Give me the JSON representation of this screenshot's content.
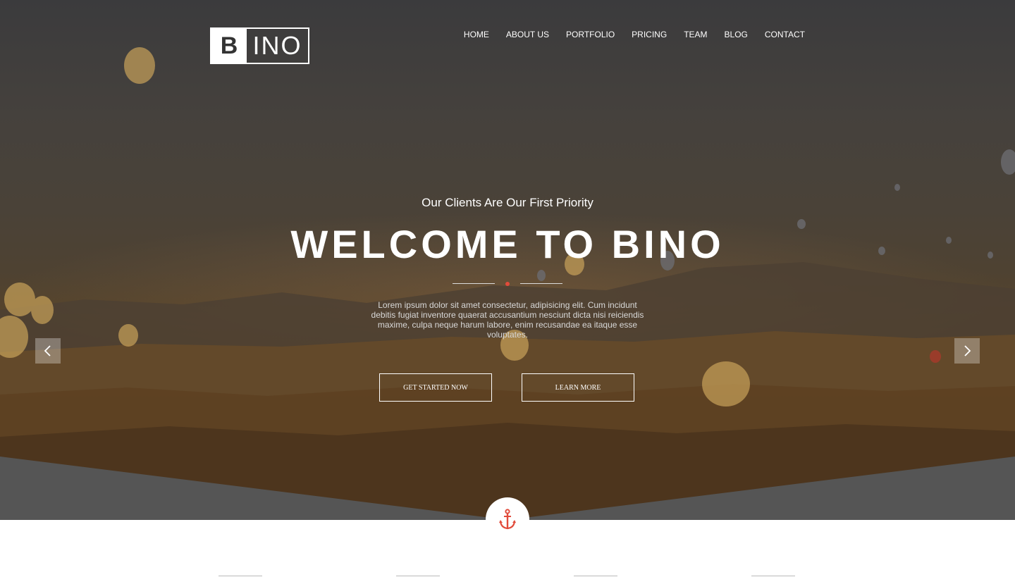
{
  "logo": {
    "letter": "B",
    "rest": "INO"
  },
  "nav": [
    "HOME",
    "ABOUT US",
    "PORTFOLIO",
    "PRICING",
    "TEAM",
    "BLOG",
    "CONTACT"
  ],
  "hero": {
    "subtitle": "Our Clients Are Our First Priority",
    "title": "WELCOME TO BINO",
    "description": "Lorem ipsum dolor sit amet consectetur, adipisicing elit. Cum incidunt debitis fugiat inventore quaerat accusantium nesciunt dicta nisi reiciendis maxime, culpa neque harum labore, enim recusandae ea itaque esse voluptates.",
    "primary_button": "GET STARTED NOW",
    "secondary_button": "LEARN MORE"
  },
  "icons": {
    "prev": "chevron-left-icon",
    "next": "chevron-right-icon",
    "anchor": "anchor-icon"
  },
  "colors": {
    "accent": "#e14b3b",
    "overlay": "#3b3b3d",
    "band": "#555555"
  }
}
